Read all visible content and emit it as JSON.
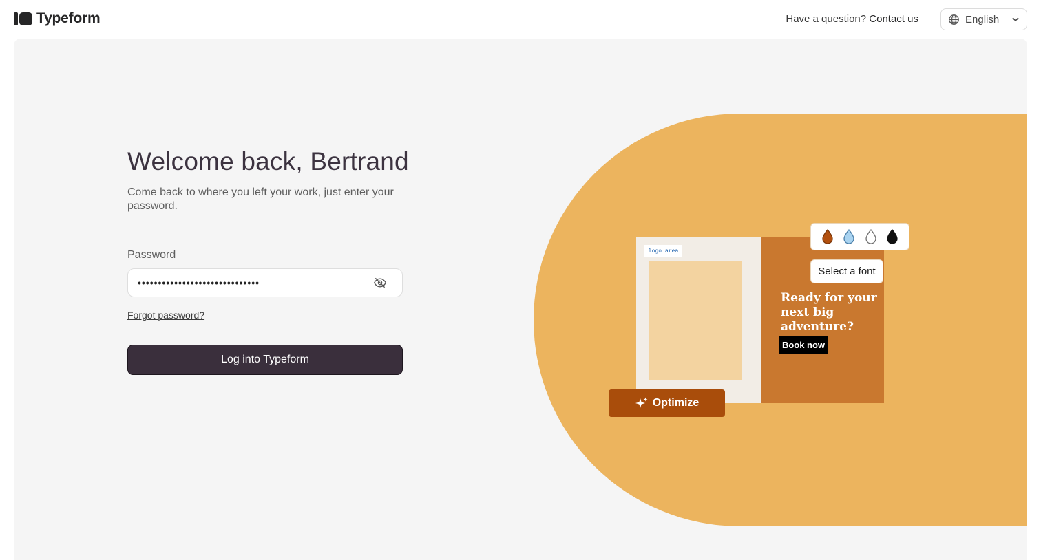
{
  "brand": {
    "name": "Typeform"
  },
  "header": {
    "question": "Have a question?",
    "contact_label": "Contact us",
    "language": "English"
  },
  "login": {
    "title": "Welcome back, Bertrand",
    "subtitle": "Come back to where you left your work, just enter your password.",
    "password_label": "Password",
    "password_mask": "••••••••••••••••••••••••••••••",
    "forgot_label": "Forgot password?",
    "submit_label": "Log into Typeform"
  },
  "illustration": {
    "logo_area": "logo area",
    "headline": "Ready for your next big adventure?",
    "cta": "Book now",
    "font_picker": "Select a font",
    "optimize": "Optimize",
    "swatches": [
      {
        "name": "rust-drop-icon",
        "fill": "#b2500f",
        "stroke": "#7a3508"
      },
      {
        "name": "light-blue-drop-icon",
        "fill": "#a9d3f0",
        "stroke": "#4a7ea8"
      },
      {
        "name": "outline-drop-icon",
        "fill": "#ffffff",
        "stroke": "#6e6e6e"
      },
      {
        "name": "black-drop-icon",
        "fill": "#111111",
        "stroke": "#111111"
      }
    ],
    "colors": {
      "blob": "#ecb45e",
      "card_right": "#c9782f",
      "optimize": "#a94d0b",
      "primary_button": "#3a2f3c"
    }
  }
}
